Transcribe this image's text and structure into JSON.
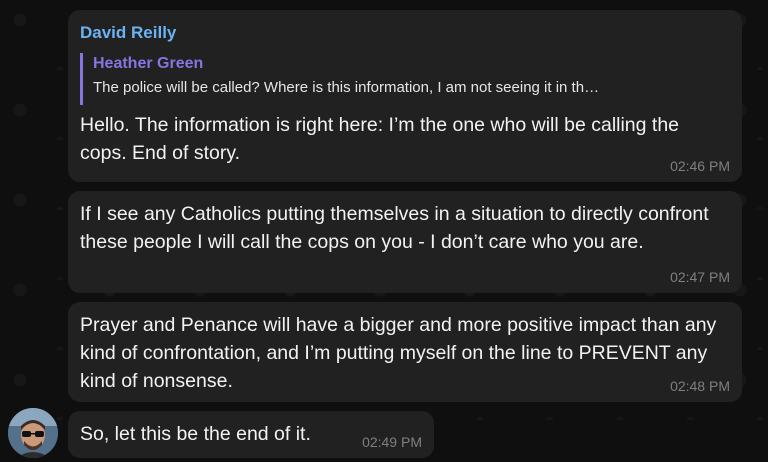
{
  "messages": [
    {
      "sender": "David Reilly",
      "reply": {
        "author": "Heather Green",
        "text": "The police will be called? Where is this information, I am not seeing it in th…"
      },
      "text": "Hello. The information is right here: I’m the one who will be calling the cops. End of story.",
      "time": "02:46 PM"
    },
    {
      "text": "If I see any Catholics putting themselves in a situation to directly confront these people I will call the cops on you - I don’t care who you are.",
      "time": "02:47 PM"
    },
    {
      "text": "Prayer and Penance will have a bigger and more positive impact than any kind of confrontation, and I’m putting myself on the line to PREVENT any kind of nonsense.",
      "time": "02:48 PM"
    },
    {
      "text": "So, let this be the end of it.",
      "time": "02:49 PM"
    }
  ],
  "colors": {
    "sender_name": "#6ab2f2",
    "reply_accent": "#8774e1",
    "bubble_bg": "#212121",
    "timestamp": "#7f7f7f"
  },
  "icons": {
    "avatar": "user-avatar-icon"
  }
}
